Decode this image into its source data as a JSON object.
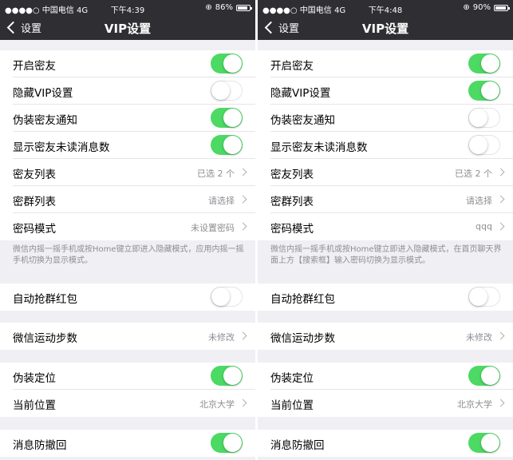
{
  "colors": {
    "toggle_on": "#4cd964",
    "bar": "#2e2e33",
    "group_bg": "#efeff4"
  },
  "screens": [
    {
      "status": {
        "carrier": "●●●●○ 中国电信  4G",
        "time": "下午4:39",
        "battery": "86%",
        "battery_level": 0.86
      },
      "nav": {
        "back": "设置",
        "title": "VIP设置"
      },
      "rows": {
        "open_friends": {
          "label": "开启密友",
          "on": true
        },
        "hide_vip": {
          "label": "隐藏VIP设置",
          "on": false
        },
        "fake_notify": {
          "label": "伪装密友通知",
          "on": true
        },
        "show_unread": {
          "label": "显示密友未读消息数",
          "on": true
        },
        "friend_list": {
          "label": "密友列表",
          "value": "已选 2 个"
        },
        "group_list": {
          "label": "密群列表",
          "value": "请选择"
        },
        "password_mode": {
          "label": "密码模式",
          "value": "未设置密码"
        },
        "note": "微信内摇一摇手机或按Home键立即进入隐藏模式，应用内摇一摇手机切换为显示模式。",
        "red_packet": {
          "label": "自动抢群红包",
          "on": false
        },
        "steps": {
          "label": "微信运动步数",
          "value": "未修改"
        },
        "fake_location": {
          "label": "伪装定位",
          "on": true
        },
        "current_location": {
          "label": "当前位置",
          "value": "北京大学"
        },
        "anti_recall": {
          "label": "消息防撤回",
          "on": true
        }
      }
    },
    {
      "status": {
        "carrier": "●●●●○ 中国电信  4G",
        "time": "下午4:48",
        "battery": "90%",
        "battery_level": 0.9
      },
      "nav": {
        "back": "设置",
        "title": "VIP设置"
      },
      "rows": {
        "open_friends": {
          "label": "开启密友",
          "on": true
        },
        "hide_vip": {
          "label": "隐藏VIP设置",
          "on": true
        },
        "fake_notify": {
          "label": "伪装密友通知",
          "on": false
        },
        "show_unread": {
          "label": "显示密友未读消息数",
          "on": false
        },
        "friend_list": {
          "label": "密友列表",
          "value": "已选 2 个"
        },
        "group_list": {
          "label": "密群列表",
          "value": "请选择"
        },
        "password_mode": {
          "label": "密码模式",
          "value": "qqq"
        },
        "note": "微信内摇一摇手机或按Home键立即进入隐藏模式，在首页聊天界面上方【搜索框】输入密码切换为显示模式。",
        "red_packet": {
          "label": "自动抢群红包",
          "on": false
        },
        "steps": {
          "label": "微信运动步数",
          "value": "未修改"
        },
        "fake_location": {
          "label": "伪装定位",
          "on": true
        },
        "current_location": {
          "label": "当前位置",
          "value": "北京大学"
        },
        "anti_recall": {
          "label": "消息防撤回",
          "on": true
        }
      }
    }
  ]
}
